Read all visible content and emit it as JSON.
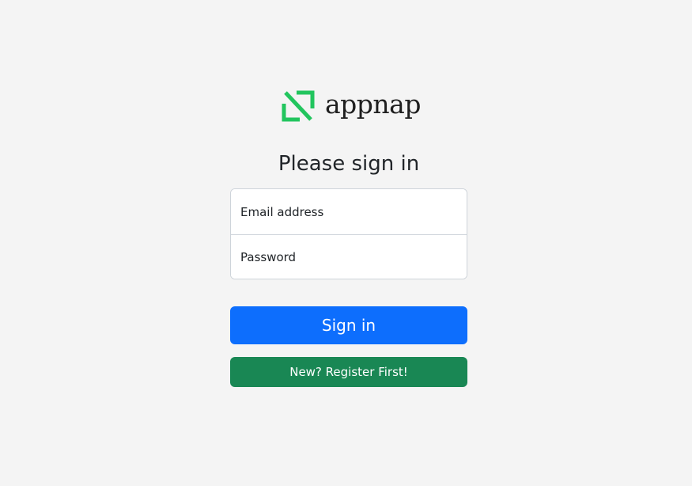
{
  "brand": {
    "name": "appnap",
    "logo_icon": "appnap-logo-icon",
    "accent_color": "#22c55e"
  },
  "title": "Please sign in",
  "form": {
    "email_placeholder": "Email address",
    "password_placeholder": "Password"
  },
  "buttons": {
    "signin_label": "Sign in",
    "signin_color": "#0d6efd",
    "register_label": "New? Register First!",
    "register_color": "#198754"
  }
}
